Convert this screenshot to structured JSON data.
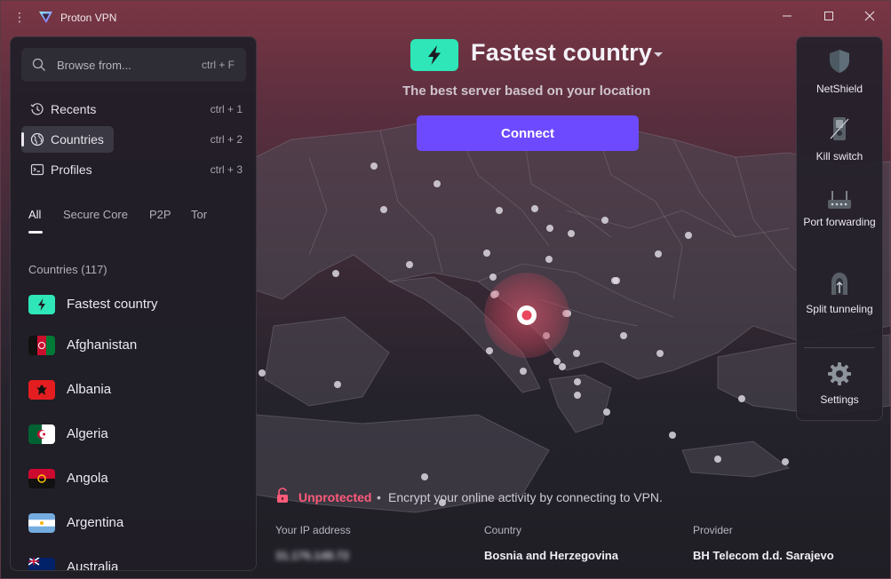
{
  "window": {
    "title": "Proton VPN"
  },
  "search": {
    "placeholder": "Browse from...",
    "shortcut": "ctrl + F"
  },
  "nav": [
    {
      "label": "Recents",
      "shortcut": "ctrl + 1",
      "icon": "clock-icon"
    },
    {
      "label": "Countries",
      "shortcut": "ctrl + 2",
      "icon": "globe-icon",
      "active": true
    },
    {
      "label": "Profiles",
      "shortcut": "ctrl + 3",
      "icon": "profile-icon"
    }
  ],
  "filters": [
    "All",
    "Secure Core",
    "P2P",
    "Tor"
  ],
  "countries_header": "Countries (117)",
  "countries": [
    {
      "name": "Fastest country"
    },
    {
      "name": "Afghanistan"
    },
    {
      "name": "Albania"
    },
    {
      "name": "Algeria"
    },
    {
      "name": "Angola"
    },
    {
      "name": "Argentina"
    },
    {
      "name": "Australia"
    }
  ],
  "header": {
    "title": "Fastest country",
    "subtitle": "The best server based on your location",
    "connect_label": "Connect"
  },
  "features": [
    {
      "label": "NetShield",
      "icon": "shield-icon"
    },
    {
      "label": "Kill switch",
      "icon": "kill-switch-icon"
    },
    {
      "label": "Port forwarding",
      "icon": "router-icon"
    },
    {
      "label": "Split tunneling",
      "icon": "split-tunnel-icon"
    },
    {
      "label": "Settings",
      "icon": "gear-icon"
    }
  ],
  "status": {
    "state": "Unprotected",
    "separator": "•",
    "message": "Encrypt your online activity by connecting to VPN."
  },
  "info": {
    "ip_label": "Your IP address",
    "ip_value": "31.176.148.72",
    "country_label": "Country",
    "country_value": "Bosnia and Herzegovina",
    "provider_label": "Provider",
    "provider_value": "BH Telecom d.d. Sarajevo"
  },
  "colors": {
    "accent": "#6d4aff",
    "fastest_green": "#2ee6b8",
    "unprotected": "#ff5a7a"
  }
}
